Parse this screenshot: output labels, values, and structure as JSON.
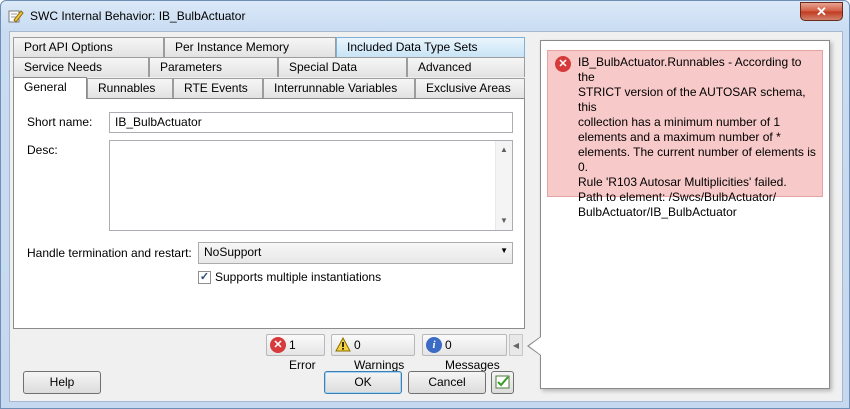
{
  "window": {
    "title": "SWC Internal Behavior: IB_BulbActuator",
    "close_glyph": "✕",
    "icon": "pencil-edit-icon"
  },
  "tabs": {
    "row1": [
      "Port API Options",
      "Per Instance Memory",
      "Included Data Type Sets"
    ],
    "row2": [
      "Service Needs",
      "Parameters",
      "Special Data",
      "Advanced"
    ],
    "row3": [
      "General",
      "Runnables",
      "RTE Events",
      "Interrunnable Variables",
      "Exclusive Areas"
    ],
    "selected": "General"
  },
  "form": {
    "short_name_label": "Short name:",
    "short_name_value": "IB_BulbActuator",
    "desc_label": "Desc:",
    "handle_label": "Handle termination and restart:",
    "handle_value": "NoSupport",
    "multi_label": "Supports multiple instantiations",
    "multi_checked": true
  },
  "status": {
    "errors": "1 Error",
    "warnings": "0 Warnings",
    "messages": "0 Messages"
  },
  "buttons": {
    "help": "Help",
    "ok": "OK",
    "cancel": "Cancel"
  },
  "error_popup": {
    "lines": [
      "IB_BulbActuator.Runnables -  According to the",
      "STRICT version of the AUTOSAR schema, this",
      "collection has a minimum number of 1",
      "elements and a maximum number of *",
      "elements. The current number of elements is",
      "0.",
      "Rule 'R103 Autosar Multiplicities' failed.",
      "Path to element: /Swcs/BulbActuator/",
      "BulbActuator/IB_BulbActuator"
    ]
  },
  "colors": {
    "error_bg": "#f8c9c9",
    "active_tab": "#c8e4f6",
    "error_icon": "#d63a3a"
  }
}
